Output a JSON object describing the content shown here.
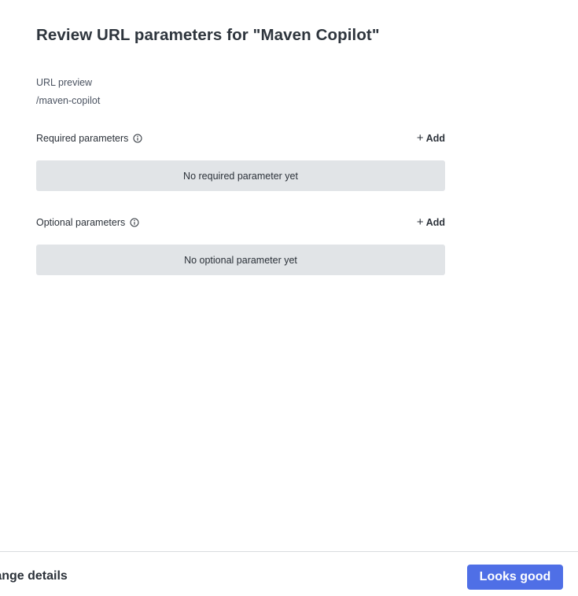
{
  "dialog": {
    "title": "Review URL parameters for \"Maven Copilot\""
  },
  "url_preview": {
    "label": "URL preview",
    "value": "/maven-copilot"
  },
  "required": {
    "title": "Required parameters",
    "info_icon": "info-icon",
    "add_label": "Add",
    "empty_text": "No required parameter yet"
  },
  "optional": {
    "title": "Optional parameters",
    "info_icon": "info-icon",
    "add_label": "Add",
    "empty_text": "No optional parameter yet"
  },
  "footer": {
    "back_label": "Change details",
    "primary_label": "Looks good"
  },
  "colors": {
    "primary": "#4f6fe6",
    "empty_box": "#e1e4e7",
    "text": "#2b3139"
  }
}
